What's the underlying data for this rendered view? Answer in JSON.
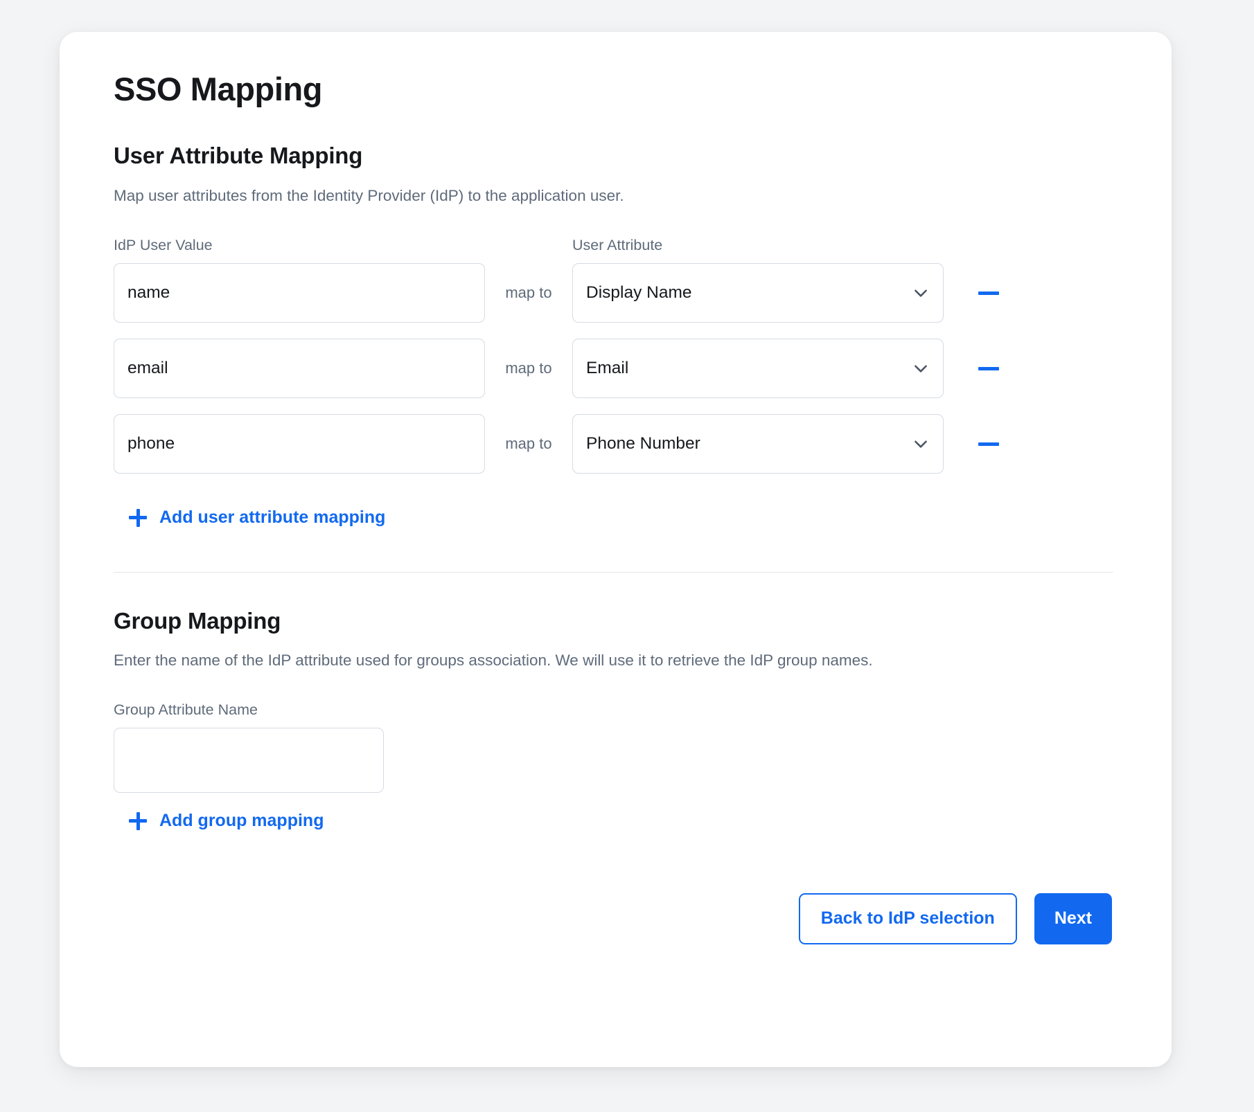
{
  "page": {
    "title": "SSO Mapping",
    "background_color": "#f3f4f5",
    "card_background": "#ffffff",
    "accent_color": "#1269f0"
  },
  "user_attribute_section": {
    "heading": "User Attribute Mapping",
    "description": "Map user attributes from the Identity Provider (IdP) to the application user.",
    "column_headers": {
      "idp_value": "IdP User Value",
      "user_attribute": "User Attribute"
    },
    "connector_label": "map to",
    "rows": [
      {
        "idp_value": "name",
        "idp_placeholder": "",
        "attribute": "Display Name"
      },
      {
        "idp_value": "email",
        "idp_placeholder": "",
        "attribute": "Email"
      },
      {
        "idp_value": "phone",
        "idp_placeholder": "",
        "attribute": "Phone Number"
      }
    ],
    "add_label": "Add user attribute mapping"
  },
  "group_section": {
    "heading": "Group Mapping",
    "description": "Enter the name of the IdP attribute used for groups association. We will use it to retrieve the IdP group names.",
    "field_label": "Group Attribute Name",
    "field_value": "",
    "field_placeholder": "",
    "add_label": "Add group mapping"
  },
  "footer": {
    "back_label": "Back to IdP selection",
    "next_label": "Next"
  }
}
